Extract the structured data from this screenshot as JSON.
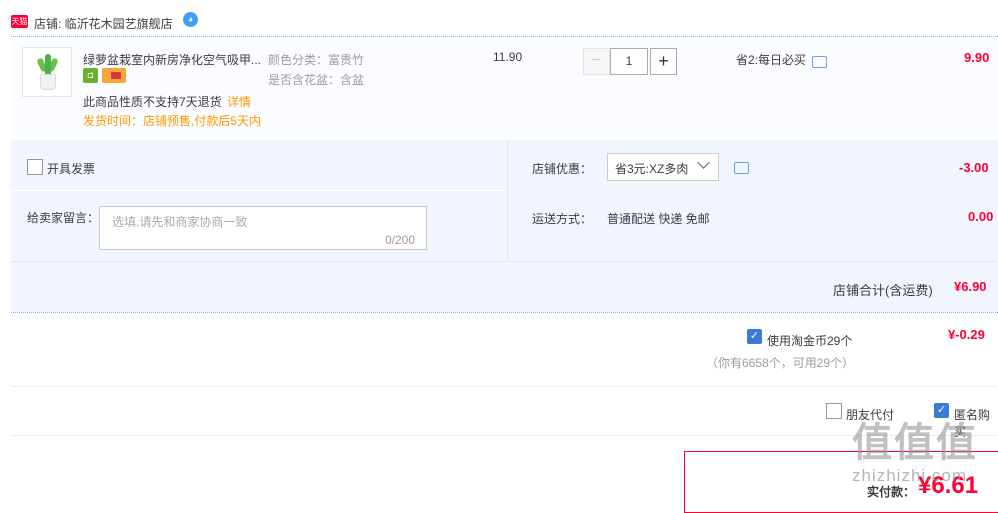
{
  "store": {
    "tmall_badge": "天猫",
    "label": "店铺: 临沂花木园艺旗舰店",
    "chat_icon": "wangwang-icon"
  },
  "item": {
    "title": "绿萝盆栽室内新房净化空气吸甲...",
    "sku_color": "颜色分类：富贵竹",
    "sku_pot": "是否含花盆：含盆",
    "no_return": "此商品性质不支持7天退货",
    "detail_link": "详情",
    "ship_time": "发货时间：店铺预售,付款后5天内",
    "unit_price": "11.90",
    "quantity": "1",
    "qty_minus": "−",
    "qty_plus": "+",
    "promo": "省2:每日必买",
    "subtotal": "9.90"
  },
  "order": {
    "invoice_label": "开具发票",
    "message_label": "给卖家留言：",
    "message_placeholder": "选填,请先和商家协商一致",
    "message_count": "0/200",
    "discount_label": "店铺优惠：",
    "discount_value": "省3元:XZ多肉",
    "discount_amount": "-3.00",
    "shipping_label": "运送方式：",
    "shipping_method": "普通配送 快递 免邮",
    "shipping_amount": "0.00",
    "store_total_label": "店铺合计(含运费)",
    "store_total_amount": "¥6.90"
  },
  "coins": {
    "label": "使用淘金币29个",
    "amount": "¥-0.29",
    "note": "（你有6658个，可用29个）"
  },
  "options": {
    "friend_pay": "朋友代付",
    "anonymous": "匿名购买"
  },
  "payment": {
    "label": "实付款：",
    "amount": "¥6.61"
  },
  "watermark": {
    "text": "值值值",
    "url": "zhizhizhi.com"
  },
  "colors": {
    "accent": "#ff0036",
    "link_orange": "#ff9900",
    "panel_bg": "#f0f5fe"
  }
}
